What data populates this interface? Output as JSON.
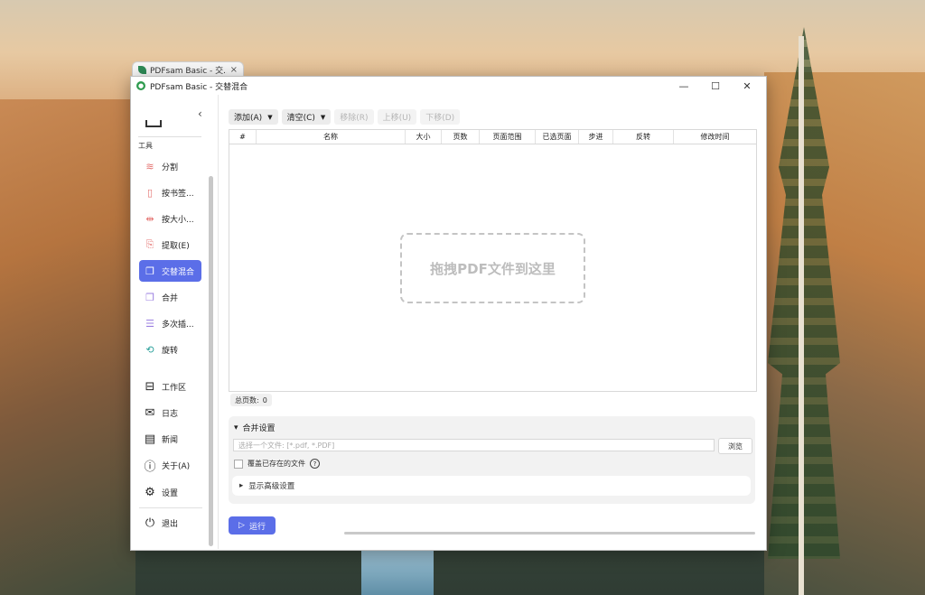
{
  "tab": {
    "title": "PDFsam Basic - 交...",
    "close": "×"
  },
  "window": {
    "title": "PDFsam Basic - 交替混合",
    "minimize": "—",
    "maximize": "☐",
    "close": "✕"
  },
  "sidebar": {
    "collapse": "‹",
    "section_label": "工具",
    "tools": [
      {
        "label": "分割",
        "icon": "split-icon"
      },
      {
        "label": "按书签...",
        "icon": "bookmark-split-icon"
      },
      {
        "label": "按大小...",
        "icon": "size-split-icon"
      },
      {
        "label": "提取(E)",
        "icon": "extract-icon"
      },
      {
        "label": "交替混合",
        "icon": "alternate-mix-icon"
      },
      {
        "label": "合并",
        "icon": "merge-icon"
      },
      {
        "label": "多次插...",
        "icon": "multi-insert-icon"
      },
      {
        "label": "旋转",
        "icon": "rotate-icon"
      }
    ],
    "bottom": [
      {
        "label": "工作区",
        "icon": "workspace-icon"
      },
      {
        "label": "日志",
        "icon": "log-icon"
      },
      {
        "label": "新闻",
        "icon": "news-icon"
      },
      {
        "label": "关于(A)",
        "icon": "info-icon"
      },
      {
        "label": "设置",
        "icon": "settings-icon"
      },
      {
        "label": "退出",
        "icon": "power-icon"
      }
    ]
  },
  "toolbar": {
    "add": "添加(A)",
    "clear": "清空(C)",
    "remove": "移除(R)",
    "move_up": "上移(U)",
    "move_down": "下移(D)"
  },
  "table": {
    "columns": [
      "#",
      "名称",
      "大小",
      "页数",
      "页面范围",
      "已选页面",
      "步进",
      "反转",
      "修改时间"
    ],
    "dropzone": "拖拽PDF文件到这里"
  },
  "page_count": {
    "label": "总页数:",
    "value": "0"
  },
  "settings": {
    "title": "合并设置",
    "file_placeholder": "选择一个文件: [*.pdf, *.PDF]",
    "browse": "浏览",
    "overwrite": "覆盖已存在的文件",
    "advanced": "显示高级设置"
  },
  "run": {
    "label": "运行"
  },
  "colors": {
    "accent": "#5b6ee8"
  }
}
